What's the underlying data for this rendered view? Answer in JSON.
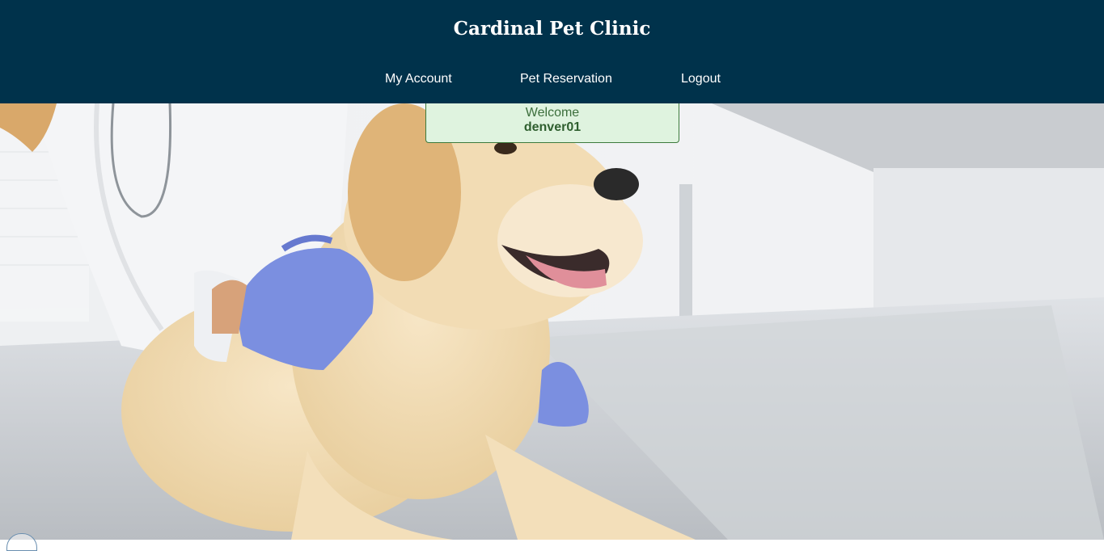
{
  "header": {
    "title": "Cardinal Pet Clinic",
    "background": "#00324b"
  },
  "nav": {
    "items": [
      {
        "label": "My Account"
      },
      {
        "label": "Pet Reservation"
      },
      {
        "label": "Logout"
      }
    ]
  },
  "welcome": {
    "label": "Welcome",
    "username": "denver01",
    "background": "#dff3df",
    "border": "#3c7a3c"
  },
  "hero": {
    "subject": "golden-retriever-puppy-vet-exam",
    "glove_color": "#7b8fe0"
  }
}
